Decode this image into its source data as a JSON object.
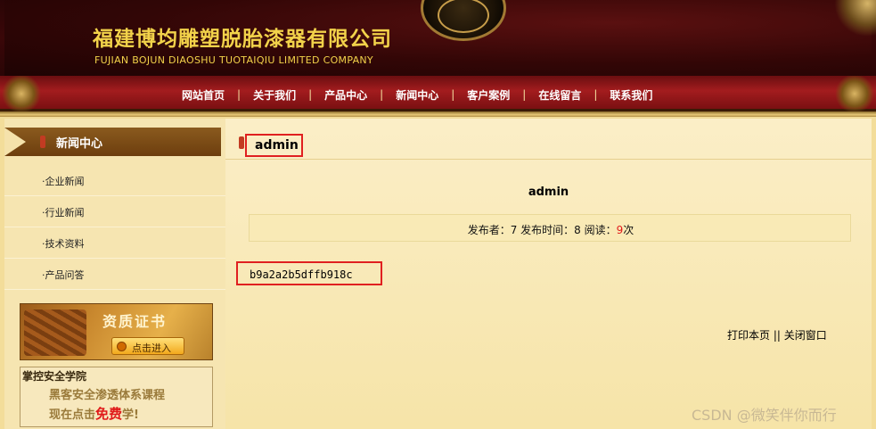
{
  "header": {
    "company_name_cn": "福建博均雕塑脱胎漆器有限公司",
    "company_name_en": "FUJIAN BOJUN DIAOSHU  TUOTAIQIU  LIMITED COMPANY"
  },
  "nav": {
    "items": [
      "网站首页",
      "关于我们",
      "产品中心",
      "新闻中心",
      "客户案例",
      "在线留言",
      "联系我们"
    ],
    "separator": "|"
  },
  "sidebar": {
    "title": "新闻中心",
    "items": [
      {
        "label": "·企业新闻"
      },
      {
        "label": "·行业新闻"
      },
      {
        "label": "·技术资料"
      },
      {
        "label": "·产品问答"
      }
    ],
    "cert": {
      "title": "资质证书",
      "button": "点击进入"
    },
    "ad": {
      "school": "掌控安全学院",
      "line1": "黑客安全渗透体系课程",
      "line2_pre": "现在点击",
      "line2_free": "免费",
      "line2_post": "学!"
    }
  },
  "main": {
    "section_title": "admin",
    "article_title": "admin",
    "meta": {
      "publisher_label": "发布者：",
      "publisher": "7",
      "time_label": " 发布时间：",
      "time": "8",
      "read_label": " 阅读：",
      "reads": "9",
      "reads_suffix": "次"
    },
    "content": "b9a2a2b5dffb918c",
    "actions": {
      "print": "打印本页",
      "sep": " || ",
      "close": "关闭窗口"
    }
  },
  "watermark": "CSDN @微笑伴你而行"
}
